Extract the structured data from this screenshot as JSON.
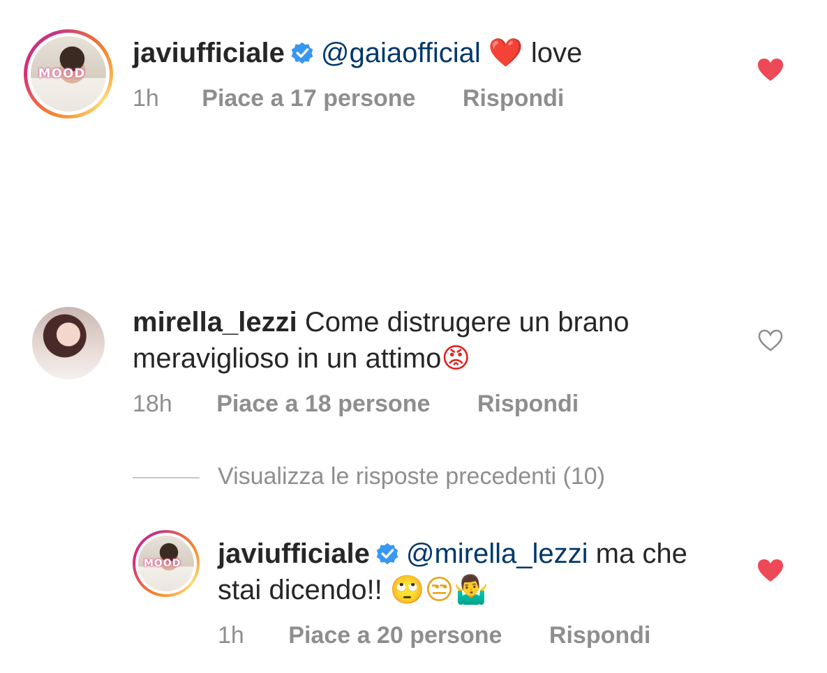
{
  "comments": [
    {
      "username": "javiufficiale",
      "verified": true,
      "avatar_badge": "MOOD",
      "mention": "@gaiaofficial",
      "emoji": "❤️",
      "text": "love",
      "time": "1h",
      "likes": "Piace a 17 persone",
      "reply": "Rispondi",
      "liked": true
    },
    {
      "username": "mirella_lezzi",
      "verified": false,
      "text_line1": "Come distrugere un brano",
      "text_line2": "meraviglioso in un attimo",
      "emoji": "😡",
      "time": "18h",
      "likes": "Piace a 18 persone",
      "reply": "Rispondi",
      "liked": false
    }
  ],
  "view_previous": "Visualizza le risposte precedenti (10)",
  "reply": {
    "username": "javiufficiale",
    "verified": true,
    "avatar_badge": "MOOD",
    "mention": "@mirella_lezzi",
    "text_line1": "ma che",
    "text_line2": "stai dicendo!!",
    "emojis": "🙄😒🤷‍♂️",
    "time": "1h",
    "likes": "Piace a 20 persone",
    "reply": "Rispondi",
    "liked": true
  },
  "colors": {
    "liked_heart": "#ed4956",
    "mention": "#00376b",
    "meta": "#8e8e8e",
    "verified": "#3897f0"
  },
  "icons": [
    "verified-badge-icon",
    "heart-filled-icon",
    "heart-outline-icon"
  ]
}
